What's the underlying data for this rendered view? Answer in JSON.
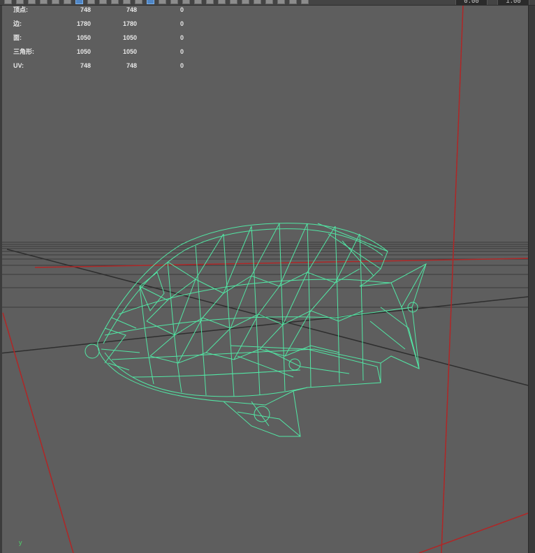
{
  "toolbar": {
    "icons": [
      "select-icon",
      "lasso-icon",
      "paint-icon",
      "move-icon",
      "rotate-icon",
      "scale-icon",
      "grid-icon",
      "grid2-icon",
      "camera-icon",
      "frame-icon",
      "film-icon",
      "frame2-icon",
      "display-icon",
      "wireframe-icon",
      "smooth-icon",
      "texture-icon",
      "checker-icon",
      "light-icon",
      "shadow-icon",
      "ao-icon",
      "aa-icon",
      "hud-icon",
      "snap-icon",
      "isolate-icon",
      "xray-icon",
      "tool-icon",
      "view-icon",
      "gamma-icon"
    ],
    "field_left": "0.00",
    "field_right": "1.00"
  },
  "hud": {
    "rows": [
      {
        "label": "顶点:",
        "a": "748",
        "b": "748",
        "c": "0"
      },
      {
        "label": "边:",
        "a": "1780",
        "b": "1780",
        "c": "0"
      },
      {
        "label": "面:",
        "a": "1050",
        "b": "1050",
        "c": "0"
      },
      {
        "label": "三角形:",
        "a": "1050",
        "b": "1050",
        "c": "0"
      },
      {
        "label": "UV:",
        "a": "748",
        "b": "748",
        "c": "0"
      }
    ]
  },
  "axis": {
    "label": "y"
  },
  "colors": {
    "wire": "#52e6a4",
    "grid": "#3a3a3a",
    "axis_red": "#c02a2a",
    "axis_dark": "#2a2a2a"
  }
}
